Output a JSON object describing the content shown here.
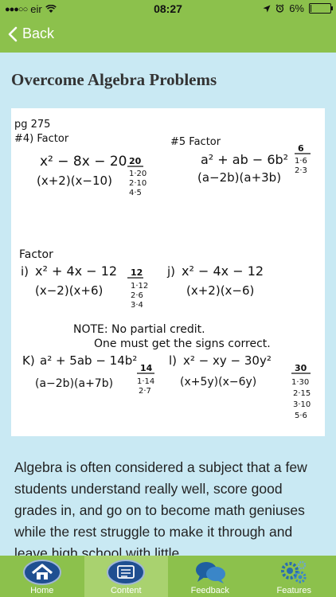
{
  "status_bar": {
    "carrier": "eir",
    "time": "08:27",
    "battery": "6%",
    "battery_level": 0.06
  },
  "nav": {
    "back_label": "Back"
  },
  "page": {
    "title": "Overcome Algebra Problems",
    "image": {
      "header": "pg 275",
      "problems": [
        {
          "num": "#4) Factor",
          "expr": "x² − 8x − 20",
          "answer": "(x+2)(x−10)",
          "factors": [
            "20",
            "1·20",
            "2·10",
            "4·5"
          ]
        },
        {
          "num": "#5 Factor",
          "expr": "a² + ab − 6b²",
          "answer": "(a−2b)(a+3b)",
          "factors": [
            "6",
            "1·6",
            "2·3"
          ]
        },
        {
          "num": "i)",
          "expr": "x² + 4x − 12",
          "answer": "(x−2)(x+6)",
          "factors": [
            "12",
            "1·12",
            "2·6",
            "3·4"
          ]
        },
        {
          "num": "j)",
          "expr": "x² − 4x − 12",
          "answer": "(x+2)(x−6)",
          "factors": []
        },
        {
          "num": "K)",
          "expr": "a² + 5ab − 14b²",
          "answer": "(a−2b)(a+7b)",
          "factors": [
            "14",
            "1·14",
            "2·7"
          ]
        },
        {
          "num": "l)",
          "expr": "x² − xy − 30y²",
          "answer": "(x+5y)(x−6y)",
          "factors": [
            "30",
            "1·30",
            "2·15",
            "3·10",
            "5·6"
          ]
        }
      ],
      "section_label": "Factor",
      "note_line1": "NOTE: No partial credit.",
      "note_line2": "One must get the signs correct."
    },
    "body_text": "Algebra is often considered a subject that a few students understand really well, score good grades in, and go on to become math geniuses while the rest struggle to make it through and leave high school with little"
  },
  "tabs": [
    {
      "label": "Home"
    },
    {
      "label": "Content"
    },
    {
      "label": "Feedback"
    },
    {
      "label": "Features"
    }
  ],
  "colors": {
    "accent": "#8cc14c",
    "background": "#c9e9f3",
    "tab_active": "#a9d26f"
  }
}
